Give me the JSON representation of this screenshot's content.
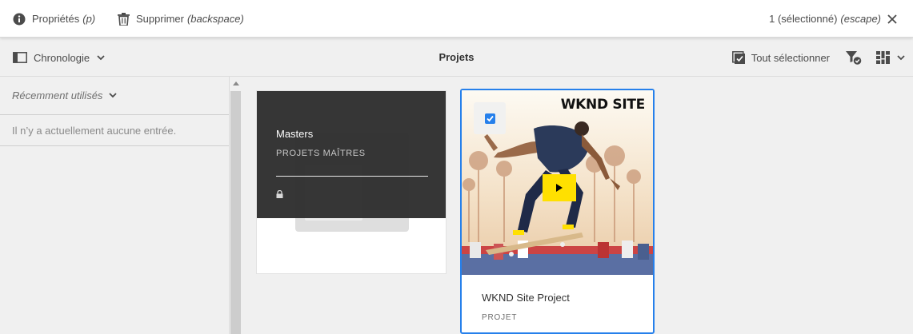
{
  "actionbar": {
    "properties_label": "Propriétés",
    "properties_key": "(p)",
    "delete_label": "Supprimer",
    "delete_key": "(backspace)",
    "selection_label": "1 (sélectionné)",
    "selection_key": "(escape)",
    "icons": [
      "info-icon",
      "trash-icon",
      "close-icon"
    ]
  },
  "toolbar": {
    "rail_toggle_label": "Chronologie",
    "title": "Projets",
    "select_all_label": "Tout sélectionner",
    "icons": [
      "rail-icon",
      "chevron-down-icon",
      "select-all-icon",
      "filter-icon",
      "card-view-icon",
      "chevron-down-icon"
    ]
  },
  "rail": {
    "recent_label": "Récemment utilisés",
    "empty_message": "Il n’y a actuellement aucune entrée."
  },
  "cards": [
    {
      "title": "Masters",
      "subtitle": "PROJETS MAÎTRES",
      "locked": true,
      "selected": false
    },
    {
      "title": "WKND Site Project",
      "subtitle": "PROJET",
      "logo_text": "WKND SITE",
      "selected": true
    }
  ],
  "colors": {
    "accent": "#2680eb",
    "overlay": "#2f2f2f",
    "play_button": "#ffe000"
  }
}
